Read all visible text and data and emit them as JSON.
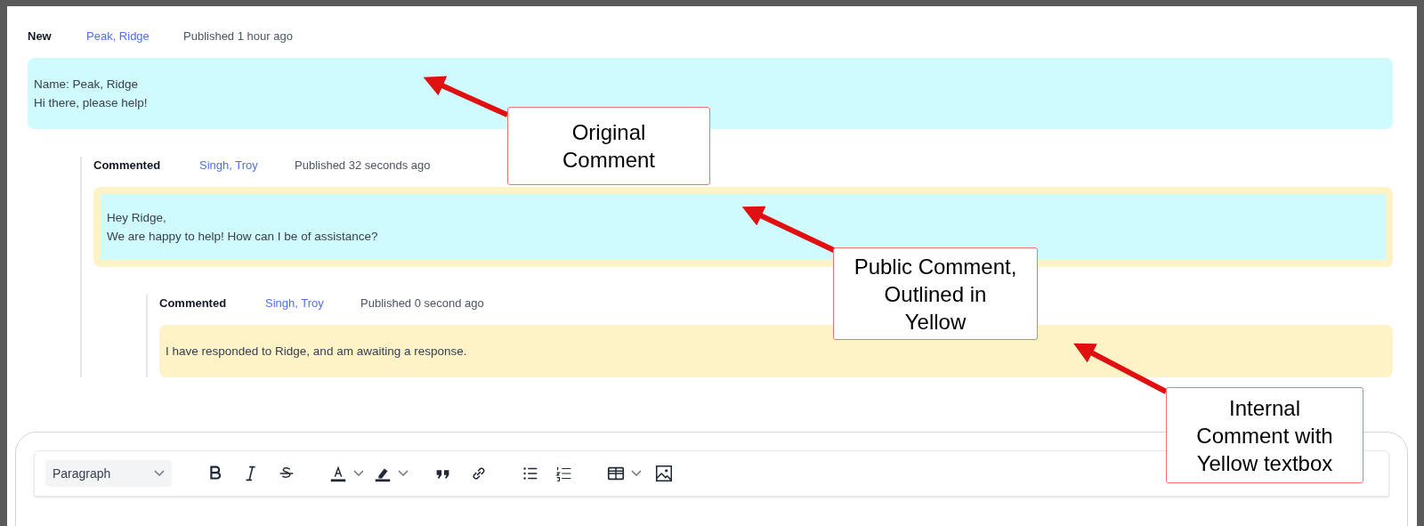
{
  "comments": [
    {
      "kind": "original",
      "status": "New",
      "author": "Peak, Ridge",
      "published": "Published 1 hour ago",
      "lines": [
        "Name: Peak, Ridge",
        "Hi there, please help!"
      ],
      "children": [
        {
          "kind": "public",
          "status": "Commented",
          "author": "Singh, Troy",
          "published": "Published 32 seconds ago",
          "lines": [
            "Hey Ridge,",
            "We are happy to help! How can I be of assistance?"
          ],
          "children": [
            {
              "kind": "internal",
              "status": "Commented",
              "author": "Singh, Troy",
              "published": "Published 0 second ago",
              "lines": [
                "I have responded to Ridge, and am awaiting a response."
              ]
            }
          ]
        }
      ]
    }
  ],
  "editor": {
    "format": "Paragraph"
  },
  "annotations": [
    {
      "lines": [
        "Original",
        "Comment"
      ]
    },
    {
      "lines": [
        "Public Comment,",
        "Outlined in",
        "Yellow"
      ]
    },
    {
      "lines": [
        "Internal",
        "Comment with",
        "Yellow textbox"
      ]
    }
  ]
}
